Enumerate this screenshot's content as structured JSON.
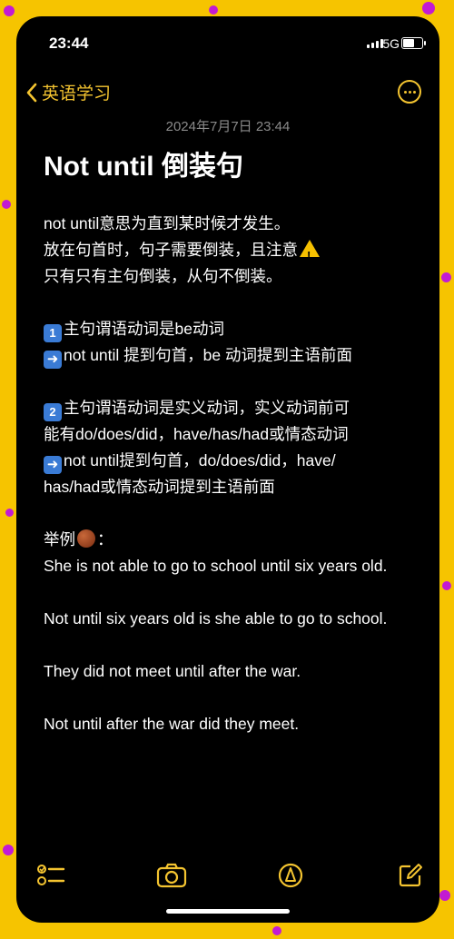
{
  "status_bar": {
    "time": "23:44",
    "network": "5G"
  },
  "nav": {
    "back_label": "英语学习",
    "back_icon": "chevron-left-icon",
    "more_icon": "ellipsis-circle-icon"
  },
  "note": {
    "date": "2024年7月7日 23:44",
    "title": "Not until 倒装句",
    "intro": [
      "not until意思为直到某时候才发生。",
      "放在句首时，句子需要倒装，且注意",
      "只有只有主句倒装，从句不倒装。"
    ],
    "point1": {
      "badge": "1",
      "line1": "主句谓语动词是be动词",
      "line2": "not until 提到句首，be 动词提到主语前面"
    },
    "point2": {
      "badge": "2",
      "line1": "主句谓语动词是实义动词，实义动词前可",
      "line2": "能有do/does/did，have/has/had或情态动词",
      "line3": "not until提到句首，do/does/did，have/",
      "line4": "has/had或情态动词提到主语前面"
    },
    "examples_label": "举例",
    "examples_colon": "：",
    "examples": [
      "She is not able to go to school until six years old.",
      "Not until six years old is she able to go to school.",
      "They did not meet until after the war.",
      "Not until after the war did they meet."
    ]
  },
  "toolbar": {
    "checklist_icon": "checklist-icon",
    "camera_icon": "camera-icon",
    "markup_icon": "markup-pen-icon",
    "compose_icon": "compose-icon"
  },
  "colors": {
    "accent": "#f4c430",
    "background": "#000000",
    "frame": "#f6c400"
  }
}
